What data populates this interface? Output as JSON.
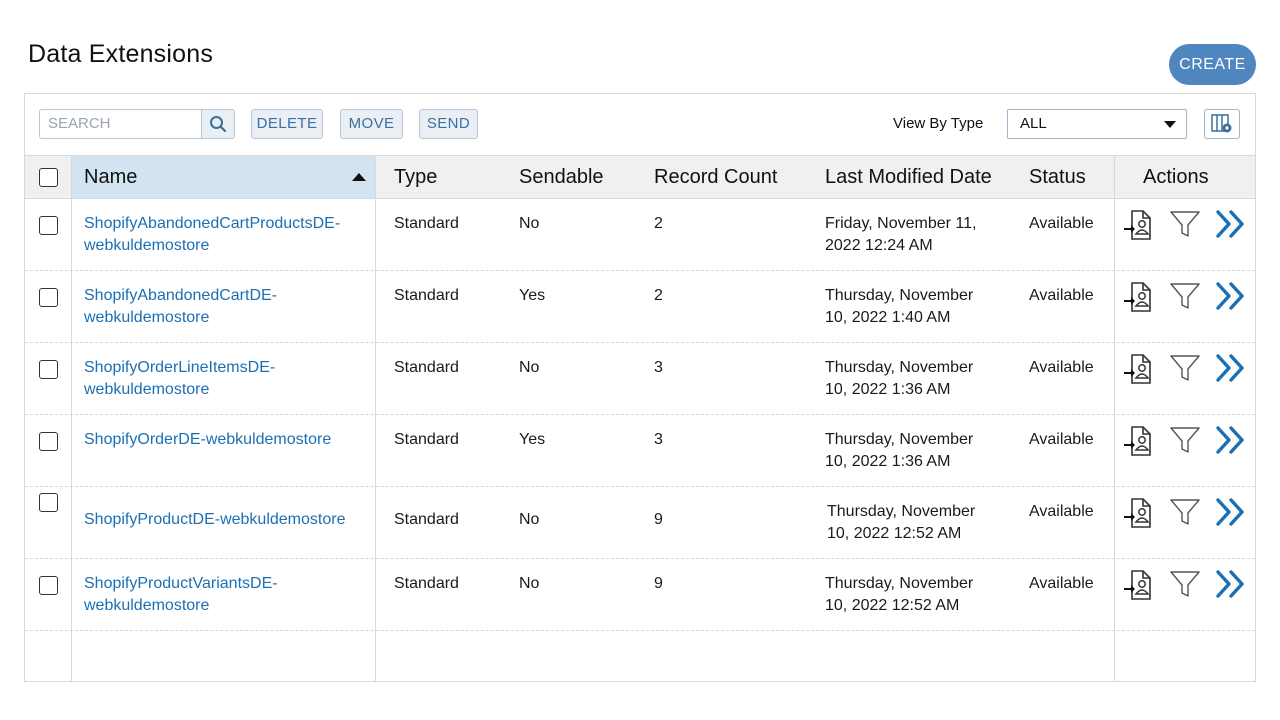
{
  "page": {
    "title": "Data Extensions",
    "create_label": "CREATE"
  },
  "toolbar": {
    "search_placeholder": "SEARCH",
    "delete_label": "DELETE",
    "move_label": "MOVE",
    "send_label": "SEND",
    "view_by_type_label": "View By Type",
    "view_by_type_value": "ALL"
  },
  "columns": {
    "name": "Name",
    "type": "Type",
    "sendable": "Sendable",
    "record_count": "Record Count",
    "last_modified": "Last Modified Date",
    "status": "Status",
    "actions": "Actions"
  },
  "sort": {
    "column": "Name",
    "direction": "ascending"
  },
  "rows": [
    {
      "name_line1": "ShopifyAbandonedCartProductsDE-",
      "name_line2": "webkuldemostore",
      "type": "Standard",
      "sendable": "No",
      "record_count": "2",
      "modified_line1": "Friday, November 11,",
      "modified_line2": "2022 12:24 AM",
      "status": "Available"
    },
    {
      "name_line1": "ShopifyAbandonedCartDE-",
      "name_line2": "webkuldemostore",
      "type": "Standard",
      "sendable": "Yes",
      "record_count": "2",
      "modified_line1": "Thursday, November",
      "modified_line2": "10, 2022 1:40 AM",
      "status": "Available"
    },
    {
      "name_line1": "ShopifyOrderLineItemsDE-",
      "name_line2": "webkuldemostore",
      "type": "Standard",
      "sendable": "No",
      "record_count": "3",
      "modified_line1": "Thursday, November",
      "modified_line2": "10, 2022 1:36 AM",
      "status": "Available"
    },
    {
      "name_line1": "ShopifyOrderDE-webkuldemostore",
      "name_line2": "",
      "type": "Standard",
      "sendable": "Yes",
      "record_count": "3",
      "modified_line1": "Thursday, November",
      "modified_line2": "10, 2022 1:36 AM",
      "status": "Available"
    },
    {
      "name_line1": "ShopifyProductDE-webkuldemostore",
      "name_line2": "",
      "type": "Standard",
      "sendable": "No",
      "record_count": "9",
      "modified_line1": "Thursday, November",
      "modified_line2": "10, 2022 12:52 AM",
      "status": "Available"
    },
    {
      "name_line1": "ShopifyProductVariantsDE-",
      "name_line2": "webkuldemostore",
      "type": "Standard",
      "sendable": "No",
      "record_count": "9",
      "modified_line1": "Thursday, November",
      "modified_line2": "10, 2022 12:52 AM",
      "status": "Available"
    }
  ],
  "row_actions": [
    "import-contacts-icon",
    "filter-icon",
    "double-chevron-right-icon"
  ],
  "colors": {
    "accent": "#4f86c0",
    "link": "#1b6fb3",
    "action_chevron": "#1b6fb3",
    "sorted_header": "#d3e4f0"
  }
}
